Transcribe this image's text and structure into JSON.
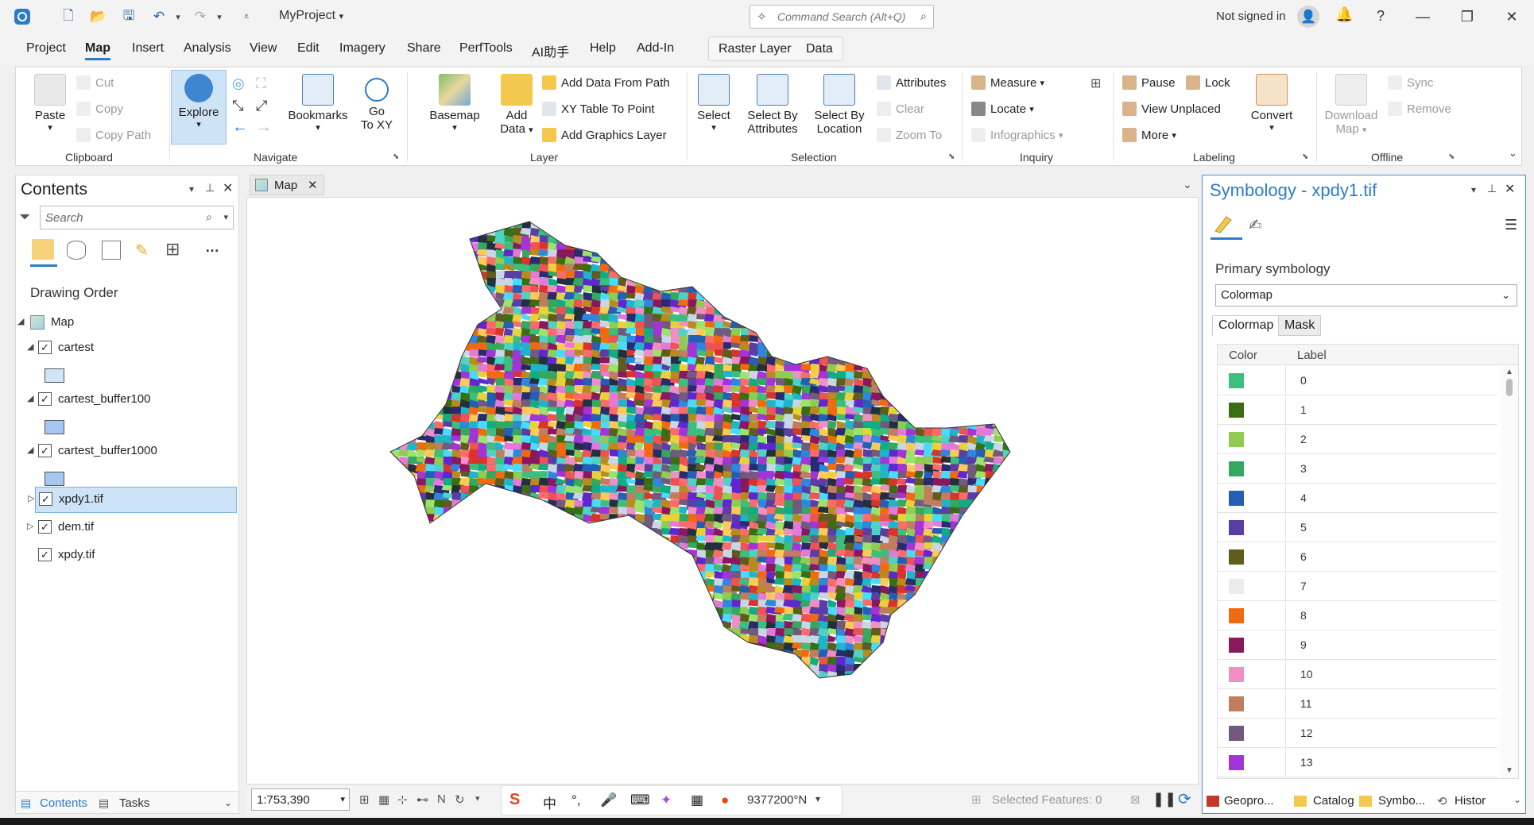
{
  "window": {
    "project_name": "MyProject",
    "command_search_placeholder": "Command Search (Alt+Q)",
    "signed_in_text": "Not signed in",
    "help": "?",
    "minimize": "—",
    "restore": "❐",
    "close": "✕"
  },
  "menu": {
    "tabs": [
      "Project",
      "Map",
      "Insert",
      "Analysis",
      "View",
      "Edit",
      "Imagery",
      "Share",
      "PerfTools",
      "AI助手",
      "Help",
      "Add-In"
    ],
    "active": "Map",
    "context_tabs": [
      "Raster Layer",
      "Data"
    ]
  },
  "ribbon": {
    "clipboard": {
      "paste": "Paste",
      "cut": "Cut",
      "copy": "Copy",
      "copy_path": "Copy Path",
      "label": "Clipboard"
    },
    "navigate": {
      "explore": "Explore",
      "bookmarks": "Bookmarks",
      "goto1": "Go",
      "goto2": "To XY",
      "label": "Navigate"
    },
    "layer": {
      "basemap": "Basemap",
      "add_data1": "Add",
      "add_data2": "Data",
      "add_from_path": "Add Data From Path",
      "xy_table": "XY Table To Point",
      "add_graphics": "Add Graphics Layer",
      "label": "Layer"
    },
    "selection": {
      "select": "Select",
      "sba1": "Select By",
      "sba2": "Attributes",
      "sbl1": "Select By",
      "sbl2": "Location",
      "attributes": "Attributes",
      "clear": "Clear",
      "zoom_to": "Zoom To",
      "label": "Selection"
    },
    "inquiry": {
      "measure": "Measure",
      "locate": "Locate",
      "infographics": "Infographics",
      "label": "Inquiry"
    },
    "labeling": {
      "pause": "Pause",
      "lock": "Lock",
      "view_unplaced": "View Unplaced",
      "more": "More",
      "convert": "Convert",
      "label": "Labeling"
    },
    "offline": {
      "download1": "Download",
      "download2": "Map",
      "sync": "Sync",
      "remove": "Remove",
      "label": "Offline"
    }
  },
  "contents": {
    "title": "Contents",
    "search_placeholder": "Search",
    "drawing_order": "Drawing Order",
    "map_label": "Map",
    "layers": [
      {
        "name": "cartest",
        "checked": "✓",
        "swatch": "#cfe6f7"
      },
      {
        "name": "cartest_buffer100",
        "checked": "✓",
        "swatch": "#a7c7f0"
      },
      {
        "name": "cartest_buffer1000",
        "checked": "✓",
        "swatch": "#a7c7f0"
      },
      {
        "name": "xpdy1.tif",
        "checked": "✓"
      },
      {
        "name": "dem.tif",
        "checked": "✓"
      },
      {
        "name": "xpdy.tif",
        "checked": "✓"
      }
    ],
    "footer_tabs": [
      "Contents",
      "Tasks"
    ]
  },
  "map": {
    "tab_label": "Map",
    "scale": "1:753,390",
    "coordinates": "9377200°N",
    "selected_features": "Selected Features: 0"
  },
  "symbology": {
    "title": "Symbology - xpdy1.tif",
    "primary_label": "Primary symbology",
    "primary_value": "Colormap",
    "tabs": [
      "Colormap",
      "Mask"
    ],
    "columns": [
      "Color",
      "Label"
    ],
    "entries": [
      {
        "label": "0",
        "color": "#3cbf7c"
      },
      {
        "label": "1",
        "color": "#3a6e12"
      },
      {
        "label": "2",
        "color": "#8fcd52"
      },
      {
        "label": "3",
        "color": "#33a85e"
      },
      {
        "label": "4",
        "color": "#245fb6"
      },
      {
        "label": "5",
        "color": "#5b3ea5"
      },
      {
        "label": "6",
        "color": "#5f5c1c"
      },
      {
        "label": "7",
        "color": "#ececec"
      },
      {
        "label": "8",
        "color": "#f26a0f"
      },
      {
        "label": "9",
        "color": "#8a185f"
      },
      {
        "label": "10",
        "color": "#ef8fc3"
      },
      {
        "label": "11",
        "color": "#c27d5e"
      },
      {
        "label": "12",
        "color": "#715a7d"
      },
      {
        "label": "13",
        "color": "#a334d6"
      }
    ]
  },
  "bottom_tabs": [
    "Geopro...",
    "Catalog",
    "Symbo...",
    "Histor"
  ]
}
